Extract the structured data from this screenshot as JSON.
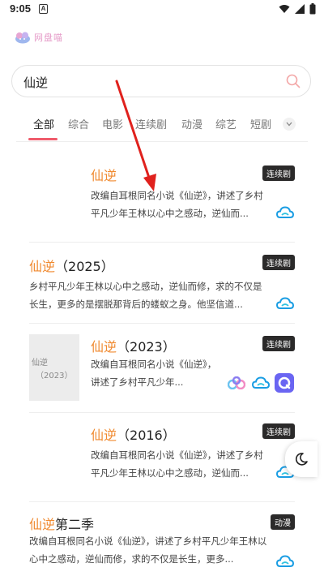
{
  "status_bar": {
    "time": "9:05",
    "notif_letter": "A"
  },
  "app": {
    "logo_text": "网盘喵"
  },
  "search": {
    "value": "仙逆"
  },
  "tabs": [
    {
      "label": "全部",
      "active": true
    },
    {
      "label": "综合"
    },
    {
      "label": "电影"
    },
    {
      "label": "连续剧"
    },
    {
      "label": "动漫"
    },
    {
      "label": "综艺"
    },
    {
      "label": "短剧"
    }
  ],
  "results": [
    {
      "title_highlight": "仙逆",
      "title_rest": "",
      "badge": "连续剧",
      "description": "改编自耳根同名小说《仙逆》，讲述了乡村平凡少年王林以心中之感动，逆仙而..."
    },
    {
      "title_highlight": "仙逆",
      "title_rest": "（2025）",
      "badge": "连续剧",
      "description": "乡村平凡少年王林以心中之感动，逆仙而修，求的不仅是长生，更多的是摆脱那背后的蝼蚁之身。他坚信道..."
    },
    {
      "title_highlight": "仙逆",
      "title_rest": "（2023）",
      "badge": "连续剧",
      "description": "改编自耳根同名小说《仙逆》，讲述了乡村平凡少年...",
      "poster_title": "仙逆",
      "poster_year": "（2023）"
    },
    {
      "title_highlight": "仙逆",
      "title_rest": "（2016）",
      "badge": "连续剧",
      "description": "改编自耳根同名小说《仙逆》，讲述了乡村平凡少年王林以心中之感动，逆仙而..."
    },
    {
      "title_highlight": "仙逆",
      "title_rest": "第二季",
      "badge": "动漫",
      "description": "改编自耳根同名小说《仙逆》，讲述了乡村平凡少年王林以心中之感动，逆仙而修，求的不仅是长生，更多..."
    }
  ],
  "colors": {
    "accent_orange": "#f08a30",
    "tab_underline": "#ef5b6b",
    "badge_bg": "#2b2a2a",
    "cloud_blue": "#1a9de3",
    "annotation_arrow": "#e0211d"
  },
  "icons": [
    "search-icon",
    "cloud-drive-icon",
    "baidu-netdisk-icon",
    "quark-icon",
    "moon-icon",
    "chevron-down-icon",
    "wifi-icon",
    "signal-icon",
    "battery-icon"
  ]
}
